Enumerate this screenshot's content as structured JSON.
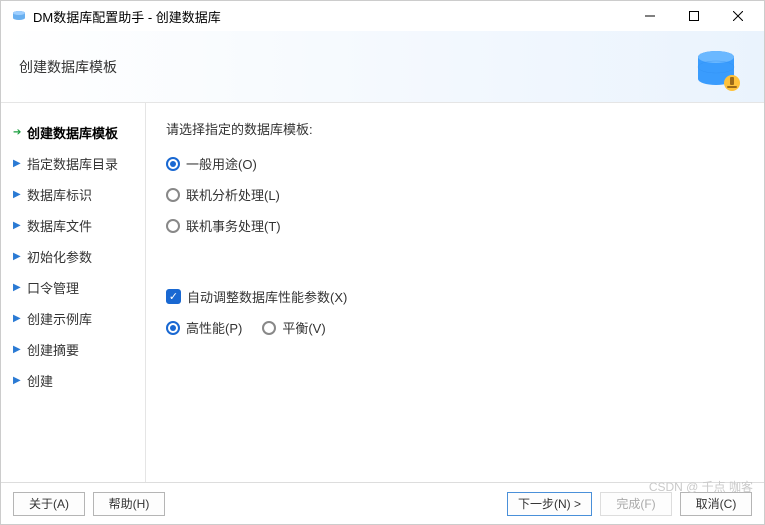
{
  "window": {
    "title": "DM数据库配置助手 - 创建数据库"
  },
  "header": {
    "title": "创建数据库模板"
  },
  "sidebar": {
    "items": [
      {
        "label": "创建数据库模板",
        "active": true
      },
      {
        "label": "指定数据库目录",
        "active": false
      },
      {
        "label": "数据库标识",
        "active": false
      },
      {
        "label": "数据库文件",
        "active": false
      },
      {
        "label": "初始化参数",
        "active": false
      },
      {
        "label": "口令管理",
        "active": false
      },
      {
        "label": "创建示例库",
        "active": false
      },
      {
        "label": "创建摘要",
        "active": false
      },
      {
        "label": "创建",
        "active": false
      }
    ]
  },
  "content": {
    "prompt": "请选择指定的数据库模板:",
    "template_radios": [
      {
        "label": "一般用途(O)",
        "checked": true
      },
      {
        "label": "联机分析处理(L)",
        "checked": false
      },
      {
        "label": "联机事务处理(T)",
        "checked": false
      }
    ],
    "auto_tune": {
      "label": "自动调整数据库性能参数(X)",
      "checked": true
    },
    "perf_radios": [
      {
        "label": "高性能(P)",
        "checked": true
      },
      {
        "label": "平衡(V)",
        "checked": false
      }
    ]
  },
  "footer": {
    "about": "关于(A)",
    "help": "帮助(H)",
    "next": "下一步(N) >",
    "finish": "完成(F)",
    "cancel": "取消(C)"
  },
  "watermark": "CSDN @ 千点 咖客"
}
